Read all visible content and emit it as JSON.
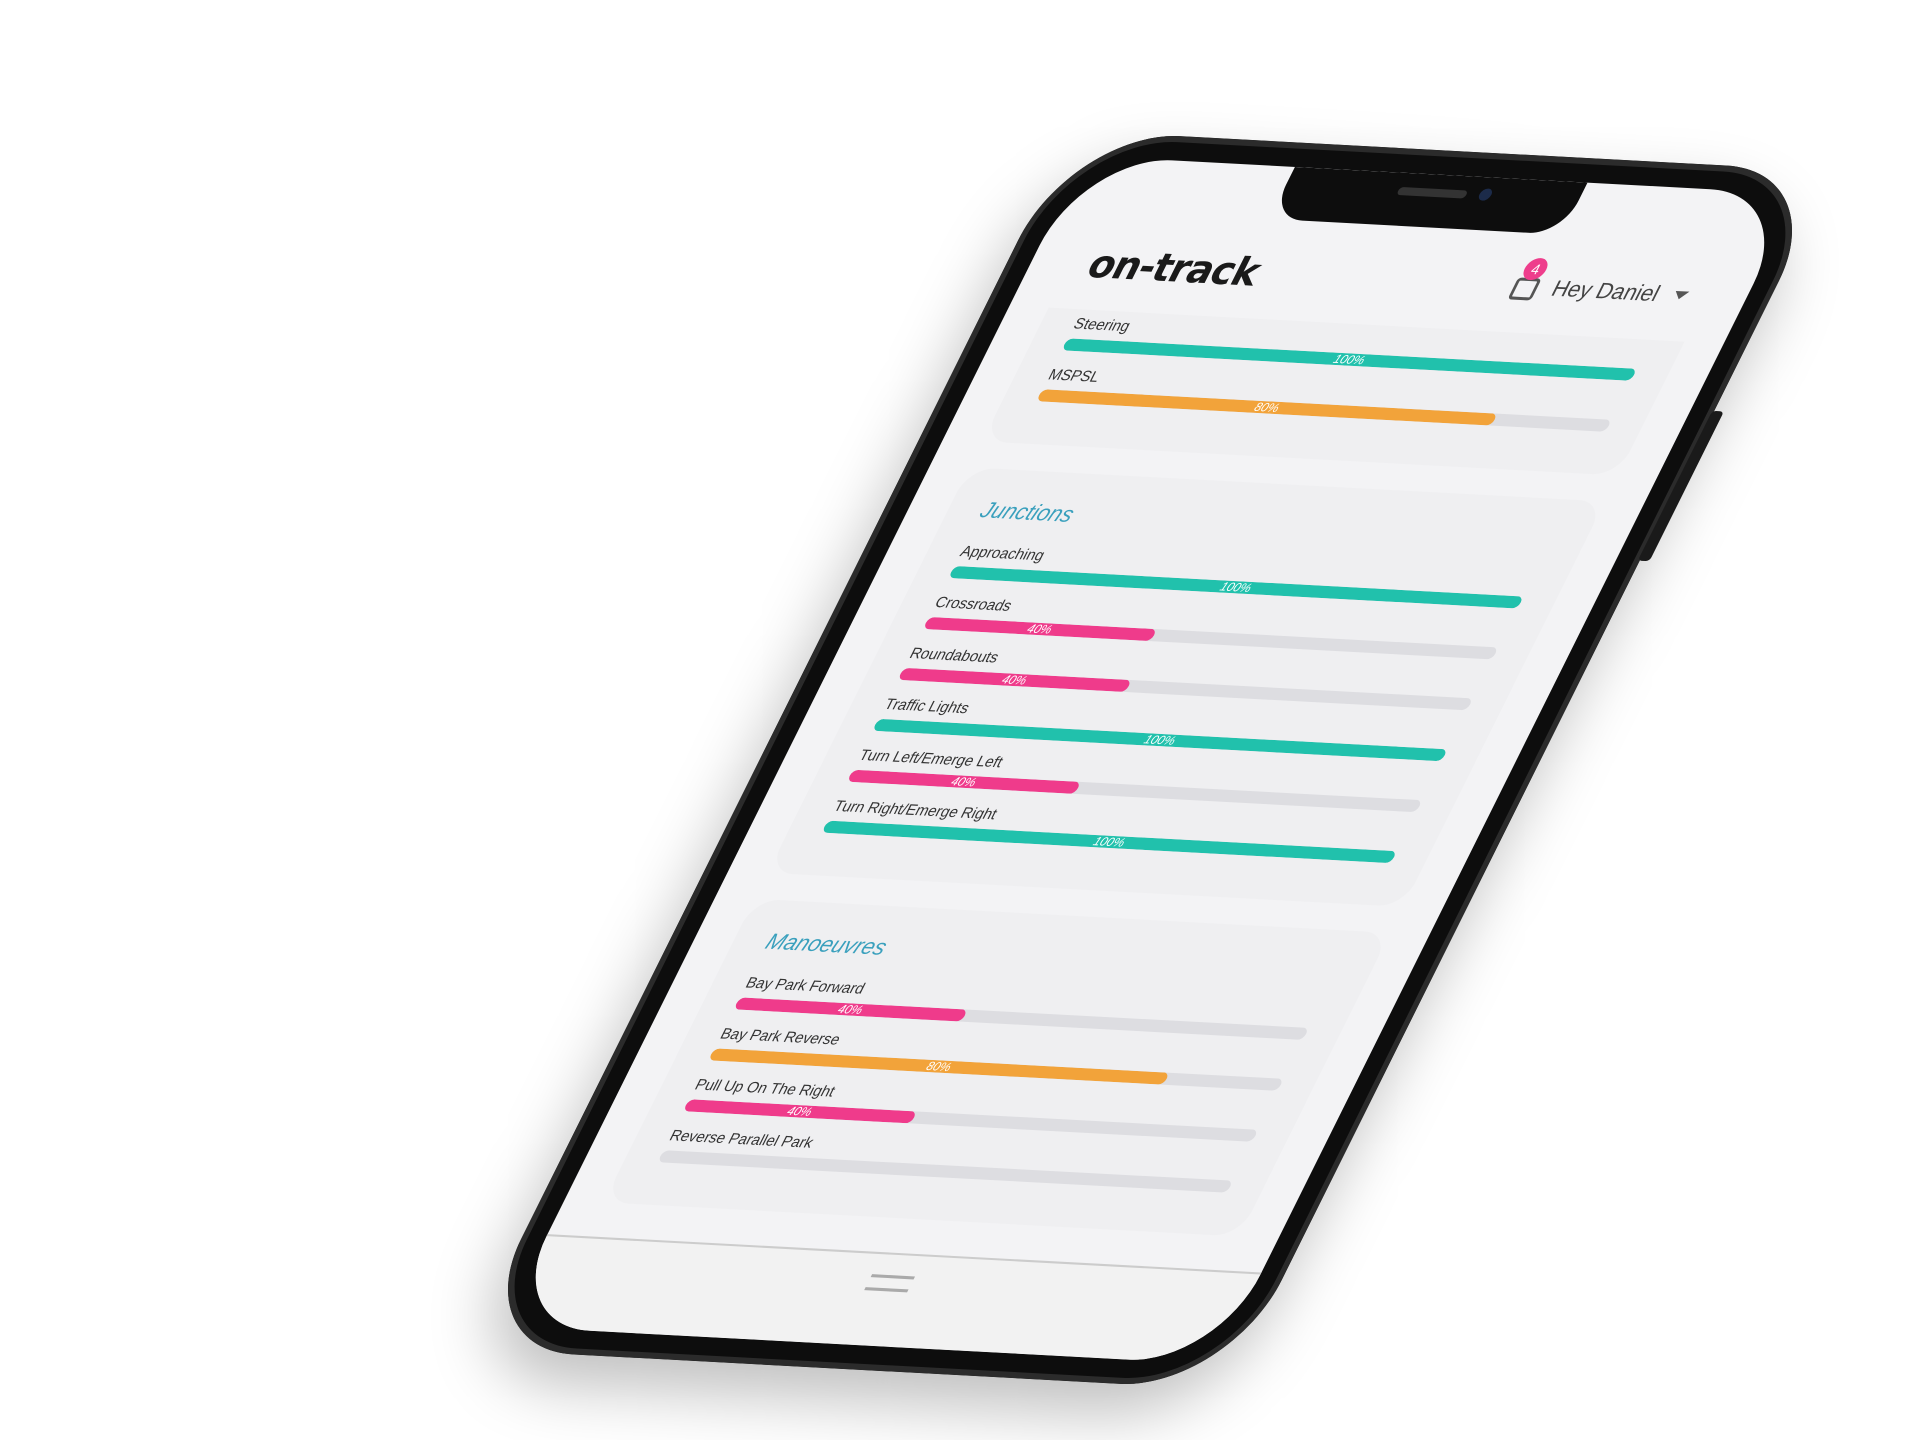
{
  "app": {
    "logo_text": "on-track",
    "greeting": "Hey Daniel",
    "notification_count": "4",
    "colors": {
      "green": "#21c1ac",
      "orange": "#f2a33a",
      "pink": "#ef3b8b",
      "title": "#3aa0bd"
    }
  },
  "sections": [
    {
      "title": "",
      "skills": [
        {
          "label": "Steering",
          "percent": 100,
          "percent_text": "100%",
          "color": "#21c1ac"
        },
        {
          "label": "MSPSL",
          "percent": 80,
          "percent_text": "80%",
          "color": "#f2a33a"
        }
      ]
    },
    {
      "title": "Junctions",
      "skills": [
        {
          "label": "Approaching",
          "percent": 100,
          "percent_text": "100%",
          "color": "#21c1ac"
        },
        {
          "label": "Crossroads",
          "percent": 40,
          "percent_text": "40%",
          "color": "#ef3b8b"
        },
        {
          "label": "Roundabouts",
          "percent": 40,
          "percent_text": "40%",
          "color": "#ef3b8b"
        },
        {
          "label": "Traffic Lights",
          "percent": 100,
          "percent_text": "100%",
          "color": "#21c1ac"
        },
        {
          "label": "Turn Left/Emerge Left",
          "percent": 40,
          "percent_text": "40%",
          "color": "#ef3b8b"
        },
        {
          "label": "Turn Right/Emerge Right",
          "percent": 100,
          "percent_text": "100%",
          "color": "#21c1ac"
        }
      ]
    },
    {
      "title": "Manoeuvres",
      "skills": [
        {
          "label": "Bay Park Forward",
          "percent": 40,
          "percent_text": "40%",
          "color": "#ef3b8b"
        },
        {
          "label": "Bay Park Reverse",
          "percent": 80,
          "percent_text": "80%",
          "color": "#f2a33a"
        },
        {
          "label": "Pull Up On The Right",
          "percent": 40,
          "percent_text": "40%",
          "color": "#ef3b8b"
        },
        {
          "label": "Reverse Parallel Park",
          "percent": 0,
          "percent_text": "",
          "color": "#ef3b8b"
        }
      ]
    }
  ]
}
